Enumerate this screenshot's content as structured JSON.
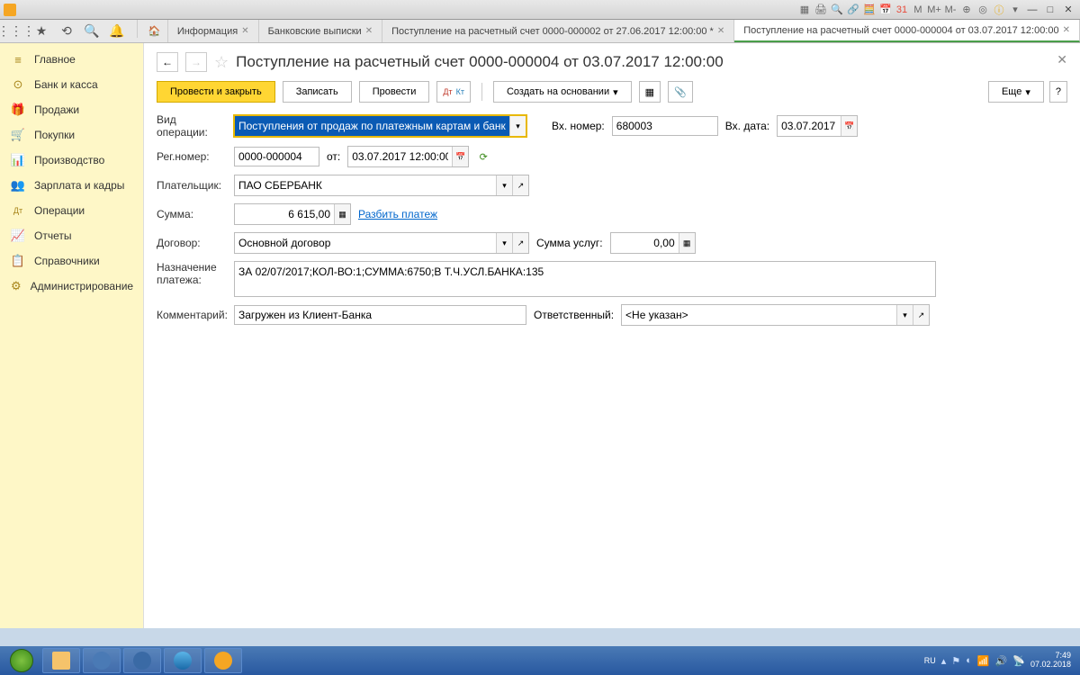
{
  "titlebar": {
    "m_plus": "M",
    "m_plus2": "M+",
    "m_minus": "M-"
  },
  "tabs": [
    {
      "label": "Информация"
    },
    {
      "label": "Банковские выписки"
    },
    {
      "label": "Поступление на расчетный счет 0000-000002 от 27.06.2017 12:00:00 *"
    },
    {
      "label": "Поступление на расчетный счет 0000-000004 от 03.07.2017 12:00:00",
      "active": true
    }
  ],
  "sidebar": [
    {
      "icon": "≡",
      "label": "Главное"
    },
    {
      "icon": "⊙",
      "label": "Банк и касса"
    },
    {
      "icon": "🎁",
      "label": "Продажи"
    },
    {
      "icon": "🛒",
      "label": "Покупки"
    },
    {
      "icon": "📊",
      "label": "Производство"
    },
    {
      "icon": "👥",
      "label": "Зарплата и кадры"
    },
    {
      "icon": "Дт",
      "label": "Операции"
    },
    {
      "icon": "📈",
      "label": "Отчеты"
    },
    {
      "icon": "📋",
      "label": "Справочники"
    },
    {
      "icon": "⚙",
      "label": "Администрирование"
    }
  ],
  "doc": {
    "title": "Поступление на расчетный счет 0000-000004 от 03.07.2017 12:00:00",
    "btn_post_close": "Провести и закрыть",
    "btn_save": "Записать",
    "btn_post": "Провести",
    "btn_dtdk": "Дт Кт",
    "btn_create_based": "Создать на основании",
    "btn_more": "Еще",
    "btn_help": "?",
    "lbl_op_type": "Вид операции:",
    "val_op_type": "Поступления от продаж по платежным картам и банковским кре",
    "lbl_inc_num": "Вх. номер:",
    "val_inc_num": "680003",
    "lbl_inc_date": "Вх. дата:",
    "val_inc_date": "03.07.2017",
    "lbl_reg_num": "Рег.номер:",
    "val_reg_num": "0000-000004",
    "lbl_from": "от:",
    "val_from": "03.07.2017 12:00:00",
    "lbl_payer": "Плательщик:",
    "val_payer": "ПАО СБЕРБАНК",
    "lbl_sum": "Сумма:",
    "val_sum": "6 615,00",
    "link_split": "Разбить платеж",
    "lbl_contract": "Договор:",
    "val_contract": "Основной договор",
    "lbl_service_sum": "Сумма услуг:",
    "val_service_sum": "0,00",
    "lbl_purpose": "Назначение платежа:",
    "val_purpose": "ЗА 02/07/2017;КОЛ-ВО:1;СУММА:6750;В Т.Ч.УСЛ.БАНКА:135",
    "lbl_comment": "Комментарий:",
    "val_comment": "Загружен из Клиент-Банка",
    "lbl_responsible": "Ответственный:",
    "val_responsible": "<Не указан>"
  },
  "taskbar": {
    "lang": "RU",
    "time": "7:49",
    "date": "07.02.2018"
  }
}
